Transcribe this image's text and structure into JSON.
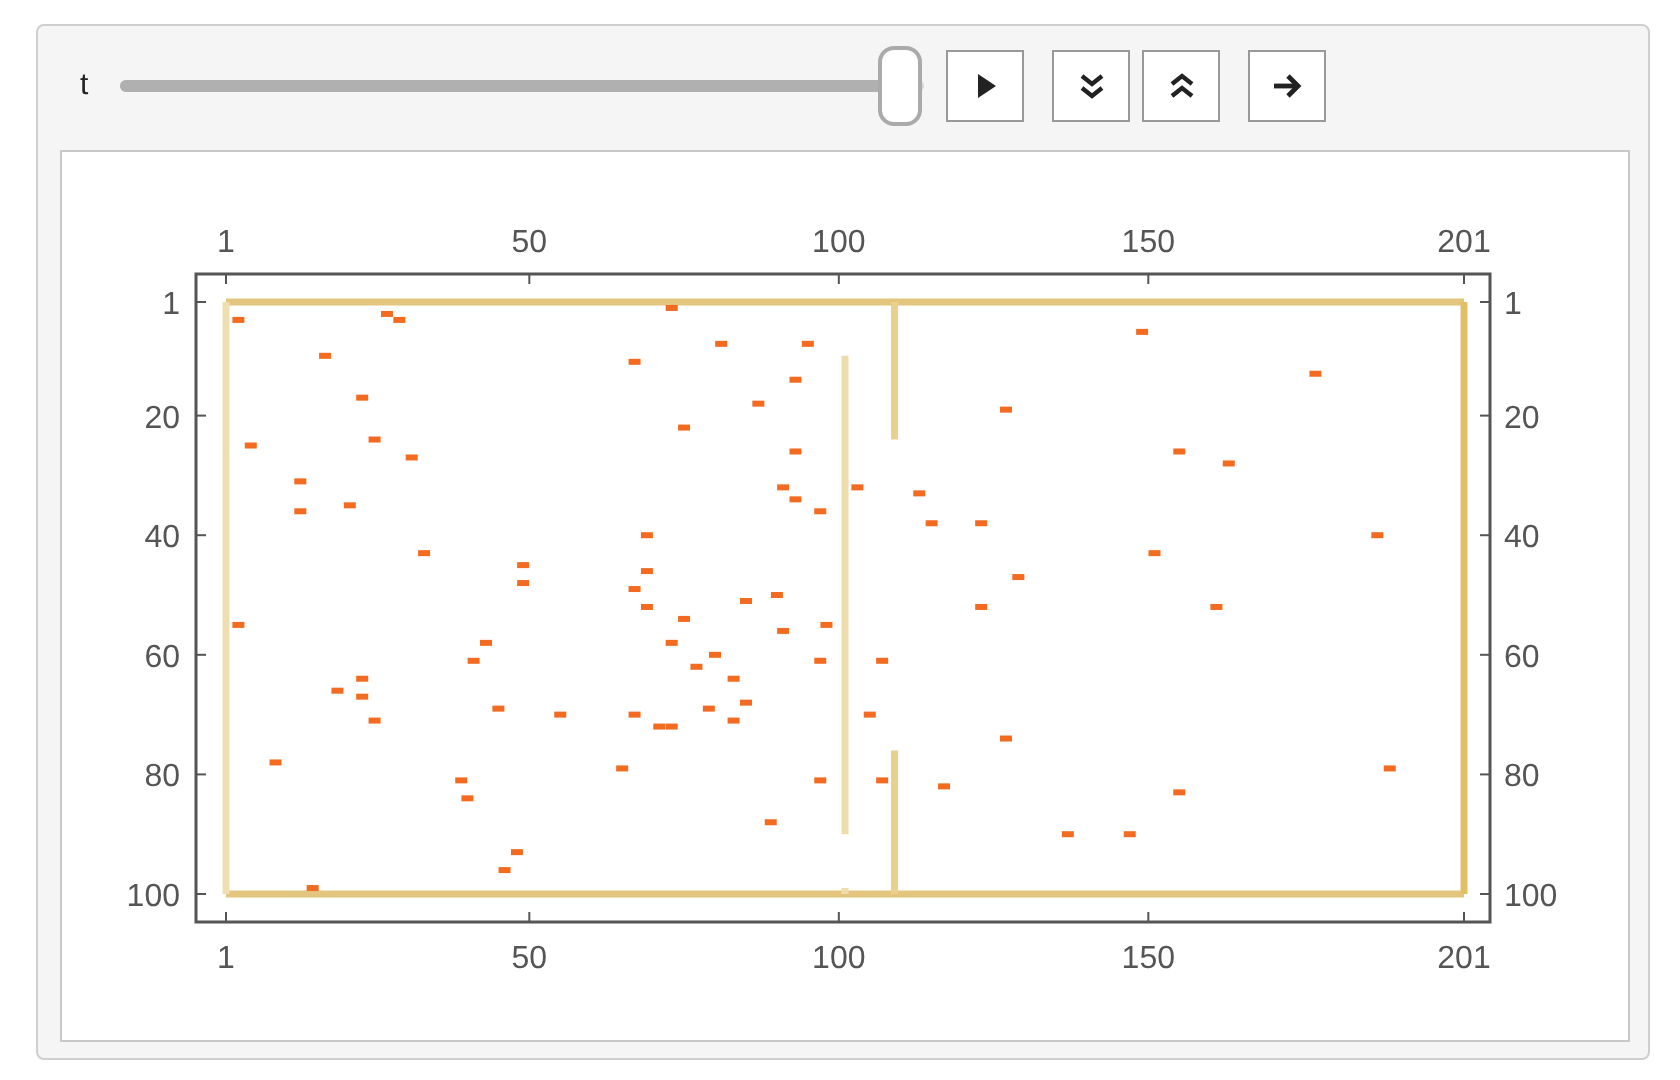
{
  "controls": {
    "variable_label": "t",
    "slider": {
      "level": 0.97
    },
    "buttons": [
      {
        "kind": "play"
      },
      {
        "kind": "slower"
      },
      {
        "kind": "faster"
      },
      {
        "kind": "direction"
      }
    ]
  },
  "plot": {
    "top_tick_labels": [
      "1",
      "50",
      "100",
      "150",
      "201"
    ],
    "bottom_tick_labels": [
      "1",
      "50",
      "100",
      "150",
      "201"
    ],
    "left_tick_labels": [
      "1",
      "20",
      "40",
      "60",
      "80",
      "100"
    ],
    "right_tick_labels": [
      "1",
      "20",
      "40",
      "60",
      "80",
      "100"
    ],
    "chart_data": {
      "type": "scatter",
      "xlim": [
        -3.85,
        205.2
      ],
      "ylim": [
        104.68,
        -3.68
      ],
      "xticks": [
        1,
        50,
        100,
        150,
        201
      ],
      "yticks": [
        1,
        20,
        40,
        60,
        80,
        100
      ],
      "x": [
        3,
        17,
        5,
        13,
        13,
        21,
        23,
        25,
        31,
        27,
        29,
        33,
        3,
        9,
        19,
        23,
        23,
        25,
        39,
        40,
        41,
        43,
        45,
        46,
        48,
        49,
        49,
        55,
        15,
        73,
        81,
        67,
        75,
        87,
        93,
        95,
        93,
        93,
        97,
        69,
        69,
        67,
        69,
        75,
        73,
        77,
        80,
        83,
        83,
        85,
        79,
        71,
        73,
        67,
        65,
        85,
        90,
        91,
        91,
        89,
        97,
        97,
        103,
        98,
        107,
        105,
        107,
        113,
        115,
        123,
        127,
        123,
        129,
        127,
        117,
        137,
        147,
        149,
        151,
        155,
        155,
        161,
        163,
        177,
        187,
        189
      ],
      "series": [
        {
          "color": "#f26b21",
          "values": [
            4,
            10,
            25,
            31,
            36,
            35,
            17,
            24,
            27,
            3,
            4,
            43,
            55,
            78,
            66,
            64,
            67,
            71,
            81,
            84,
            61,
            58,
            69,
            96,
            93,
            45,
            48,
            70,
            99,
            2,
            8,
            11,
            22,
            18,
            14,
            8,
            26,
            34,
            36,
            40,
            46,
            49,
            52,
            54,
            58,
            62,
            60,
            64,
            71,
            68,
            69,
            72,
            72,
            70,
            79,
            51,
            50,
            56,
            32,
            88,
            61,
            81,
            32,
            55,
            61,
            70,
            81,
            33,
            38,
            38,
            19,
            52,
            47,
            74,
            82,
            90,
            90,
            6,
            43,
            26,
            83,
            52,
            28,
            13,
            40,
            79
          ]
        }
      ]
    }
  }
}
